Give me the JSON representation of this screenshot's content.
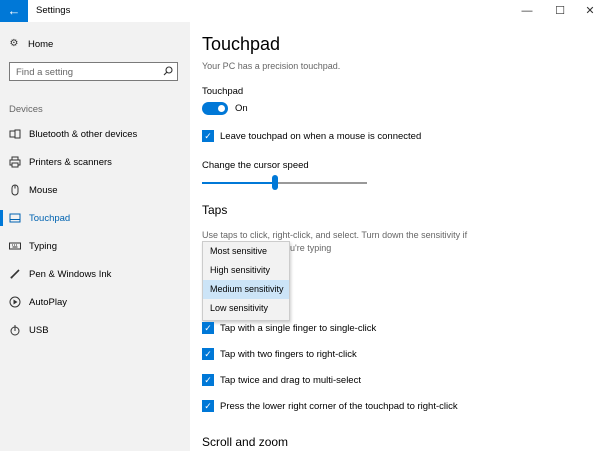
{
  "window": {
    "title": "Settings",
    "back_glyph": "←",
    "minimize_glyph": "—",
    "maximize_glyph": "☐",
    "close_glyph": "✕"
  },
  "sidebar": {
    "home_label": "Home",
    "search_placeholder": "Find a setting",
    "section_label": "Devices",
    "items": [
      {
        "label": "Bluetooth & other devices",
        "icon": "bluetooth-icon"
      },
      {
        "label": "Printers & scanners",
        "icon": "printer-icon"
      },
      {
        "label": "Mouse",
        "icon": "mouse-icon"
      },
      {
        "label": "Touchpad",
        "icon": "touchpad-icon",
        "active": true
      },
      {
        "label": "Typing",
        "icon": "keyboard-icon"
      },
      {
        "label": "Pen & Windows Ink",
        "icon": "pen-icon"
      },
      {
        "label": "AutoPlay",
        "icon": "autoplay-icon"
      },
      {
        "label": "USB",
        "icon": "usb-icon"
      }
    ]
  },
  "main": {
    "title": "Touchpad",
    "subtitle": "Your PC has a precision touchpad.",
    "touchpad_label": "Touchpad",
    "toggle_state": "On",
    "leave_on_label": "Leave touchpad on when a mouse is connected",
    "cursor_speed_label": "Change the cursor speed",
    "cursor_speed_value": 0.44,
    "taps_heading": "Taps",
    "taps_desc_line1": "Use taps to click, right-click, and select. Turn down the sensitivity if",
    "taps_desc_line2": "u're typing",
    "sensitivity_options": [
      "Most sensitive",
      "High sensitivity",
      "Medium sensitivity",
      "Low sensitivity"
    ],
    "sensitivity_selected": "Medium sensitivity",
    "tap_options": [
      "Tap with a single finger to single-click",
      "Tap with two fingers to right-click",
      "Tap twice and drag to multi-select",
      "Press the lower right corner of the touchpad to right-click"
    ],
    "scroll_heading": "Scroll and zoom"
  },
  "colors": {
    "accent": "#0078d7",
    "sidebar_bg": "#f2f2f2",
    "selected_option_bg": "#cce4f7"
  }
}
